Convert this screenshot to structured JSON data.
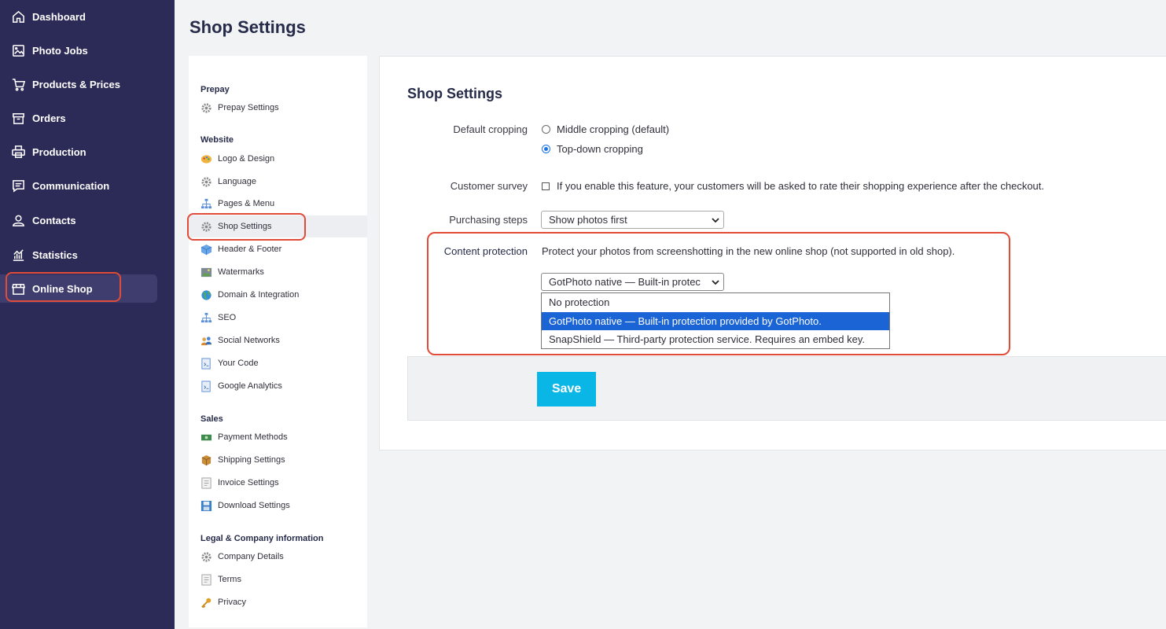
{
  "nav": {
    "items": [
      {
        "label": "Dashboard",
        "icon": "home-icon"
      },
      {
        "label": "Photo Jobs",
        "icon": "image-icon"
      },
      {
        "label": "Products & Prices",
        "icon": "cart-icon"
      },
      {
        "label": "Orders",
        "icon": "box-icon"
      },
      {
        "label": "Production",
        "icon": "printer-icon"
      },
      {
        "label": "Communication",
        "icon": "message-icon"
      },
      {
        "label": "Contacts",
        "icon": "user-icon"
      },
      {
        "label": "Statistics",
        "icon": "chart-icon"
      },
      {
        "label": "Online Shop",
        "icon": "store-icon",
        "active": true
      }
    ]
  },
  "page": {
    "title": "Shop Settings"
  },
  "menu": {
    "groups": {
      "prepay": "Prepay",
      "website": "Website",
      "sales": "Sales",
      "legal": "Legal & Company information"
    },
    "items": {
      "prepay_settings": "Prepay Settings",
      "logo_design": "Logo & Design",
      "language": "Language",
      "pages_menu": "Pages & Menu",
      "shop_settings": "Shop Settings",
      "header_footer": "Header & Footer",
      "watermarks": "Watermarks",
      "domain_integration": "Domain & Integration",
      "seo": "SEO",
      "social_networks": "Social Networks",
      "your_code": "Your Code",
      "google_analytics": "Google Analytics",
      "payment_methods": "Payment Methods",
      "shipping_settings": "Shipping Settings",
      "invoice_settings": "Invoice Settings",
      "download_settings": "Download Settings",
      "company_details": "Company Details",
      "terms": "Terms",
      "privacy": "Privacy"
    }
  },
  "form": {
    "title": "Shop Settings",
    "cropping": {
      "label": "Default cropping",
      "options": [
        "Middle cropping (default)",
        "Top-down cropping"
      ],
      "selected": "Top-down cropping"
    },
    "survey": {
      "label": "Customer survey",
      "text": "If you enable this feature, your customers will be asked to rate their shopping experience after the checkout.",
      "checked": false
    },
    "purchasing": {
      "label": "Purchasing steps",
      "value": "Show photos first"
    },
    "protection": {
      "label": "Content protection",
      "description": "Protect your photos from screenshotting in the new online shop (not supported in old shop).",
      "value": "GotPhoto native — Built-in protec",
      "options": [
        "No protection",
        "GotPhoto native — Built-in protection provided by GotPhoto.",
        "SnapShield — Third-party protection service. Requires an embed key."
      ],
      "selected_index": 1
    },
    "save_label": "Save"
  },
  "colors": {
    "nav_bg": "#2c2b57",
    "highlight": "#e14b3a",
    "save": "#0ab6e6",
    "selection": "#1a64d6"
  }
}
